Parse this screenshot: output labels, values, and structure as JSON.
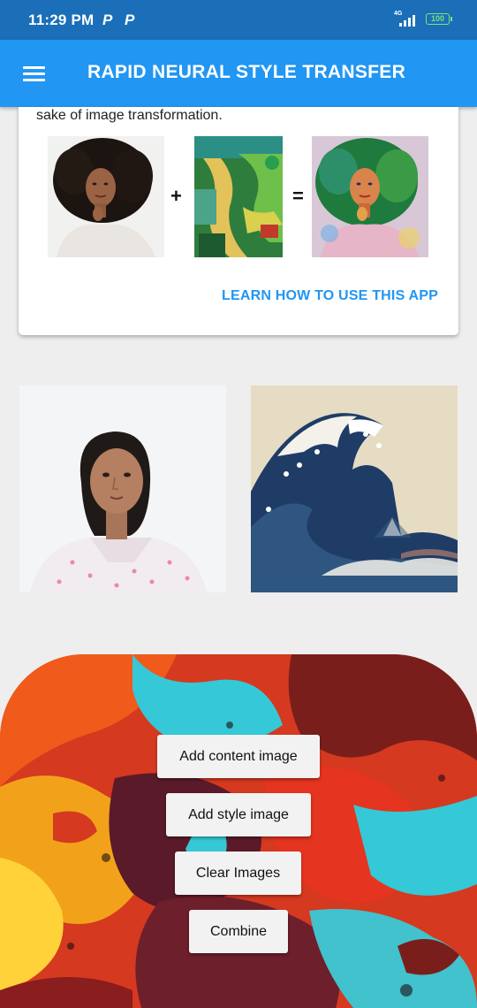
{
  "status_bar": {
    "time": "11:29 PM",
    "notif_1": "P",
    "notif_2": "P",
    "network": "4G",
    "battery": "100"
  },
  "app_bar": {
    "title": "RAPID NEURAL STYLE TRANSFER",
    "menu_icon": "hamburger-menu-icon"
  },
  "info_card": {
    "text": "sake of image transformation.",
    "operator_plus": "+",
    "operator_equals": "=",
    "learn_link": "LEARN HOW TO USE THIS APP"
  },
  "buttons": {
    "add_content": "Add content image",
    "add_style": "Add style image",
    "clear": "Clear Images",
    "combine": "Combine"
  },
  "colors": {
    "status_bar": "#1a6fb8",
    "app_bar": "#2196f3",
    "accent": "#2196f3"
  }
}
